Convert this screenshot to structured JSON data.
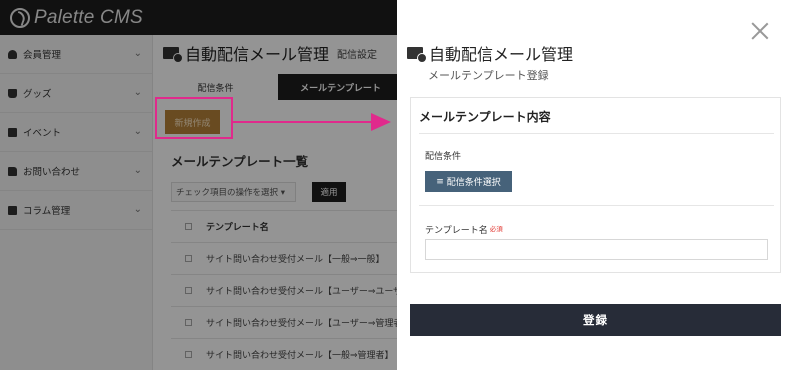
{
  "app": {
    "logo_text": "Palette CMS"
  },
  "sidebar": {
    "items": [
      {
        "label": "会員管理",
        "icon": "user-icon"
      },
      {
        "label": "グッズ",
        "icon": "shopping-bag-icon"
      },
      {
        "label": "イベント",
        "icon": "calendar-icon"
      },
      {
        "label": "お問い合わせ",
        "icon": "folder-icon"
      },
      {
        "label": "コラム管理",
        "icon": "book-icon"
      }
    ]
  },
  "main": {
    "title": "自動配信メール管理",
    "subtitle": "配信設定",
    "tabs": [
      {
        "label": "配信条件",
        "active": false
      },
      {
        "label": "メールテンプレート",
        "active": true
      }
    ],
    "new_button": "新規作成",
    "list_title": "メールテンプレート一覧",
    "bulk_select": "チェック項目の操作を選択 ▾",
    "apply_button": "適用",
    "table": {
      "header": "テンプレート名",
      "rows": [
        "サイト問い合わせ受付メール【一般⇒一般】",
        "サイト問い合わせ受付メール【ユーザー⇒ユーザー】",
        "サイト問い合わせ受付メール【ユーザー⇒管理者】",
        "サイト問い合わせ受付メール【一般⇒管理者】"
      ]
    }
  },
  "panel": {
    "title": "自動配信メール管理",
    "subtitle": "メールテンプレート登録",
    "card_title": "メールテンプレート内容",
    "condition_label": "配信条件",
    "condition_button": "配信条件選択",
    "name_label": "テンプレート名",
    "required_badge": "必須",
    "name_value": "",
    "submit_button": "登録"
  },
  "colors": {
    "annotation": "#e02a8c",
    "new_button": "#b5813a",
    "condition_button": "#46627a",
    "submit_button": "#272c38",
    "topbar": "#1e1e1e"
  }
}
